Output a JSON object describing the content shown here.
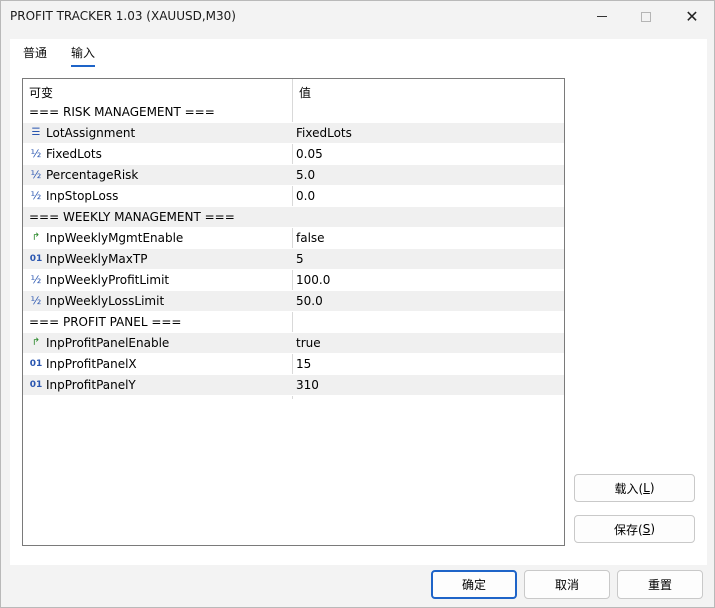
{
  "window": {
    "title": "PROFIT TRACKER 1.03 (XAUUSD,M30)",
    "minimize": "—",
    "close": "✕"
  },
  "tabs": [
    {
      "label": "普通",
      "active": false
    },
    {
      "label": "输入",
      "active": true
    }
  ],
  "grid": {
    "headers": {
      "variable": "可变",
      "value": "值"
    },
    "rows": [
      {
        "name": "=== RISK MANAGEMENT ===",
        "value": "",
        "icon": "",
        "icon_name": "none"
      },
      {
        "name": "LotAssignment",
        "value": "FixedLots",
        "icon": "☰",
        "icon_name": "enum-icon"
      },
      {
        "name": "FixedLots",
        "value": "0.05",
        "icon": "½",
        "icon_name": "double-icon"
      },
      {
        "name": "PercentageRisk",
        "value": "5.0",
        "icon": "½",
        "icon_name": "double-icon"
      },
      {
        "name": "InpStopLoss",
        "value": "0.0",
        "icon": "½",
        "icon_name": "double-icon"
      },
      {
        "name": "=== WEEKLY MANAGEMENT ===",
        "value": "",
        "icon": "",
        "icon_name": "none"
      },
      {
        "name": "InpWeeklyMgmtEnable",
        "value": "false",
        "icon": "↱",
        "icon_name": "bool-icon"
      },
      {
        "name": "InpWeeklyMaxTP",
        "value": "5",
        "icon": "01",
        "icon_name": "int-icon"
      },
      {
        "name": "InpWeeklyProfitLimit",
        "value": "100.0",
        "icon": "½",
        "icon_name": "double-icon"
      },
      {
        "name": "InpWeeklyLossLimit",
        "value": "50.0",
        "icon": "½",
        "icon_name": "double-icon"
      },
      {
        "name": "=== PROFIT PANEL ===",
        "value": "",
        "icon": "",
        "icon_name": "none"
      },
      {
        "name": "InpProfitPanelEnable",
        "value": "true",
        "icon": "↱",
        "icon_name": "bool-icon"
      },
      {
        "name": "InpProfitPanelX",
        "value": "15",
        "icon": "01",
        "icon_name": "int-icon"
      },
      {
        "name": "InpProfitPanelY",
        "value": "310",
        "icon": "01",
        "icon_name": "int-icon"
      }
    ]
  },
  "side_buttons": {
    "load_label": "载入(",
    "load_key": "L",
    "load_end": ")",
    "save_label": "保存(",
    "save_key": "S",
    "save_end": ")"
  },
  "bottom_buttons": {
    "ok": "确定",
    "cancel": "取消",
    "reset": "重置"
  },
  "colors": {
    "accent": "#1e64c8",
    "icon_blue": "#2a56b0",
    "bool_green": "#2e8b2e",
    "row_shade": "#f0f0f0"
  }
}
